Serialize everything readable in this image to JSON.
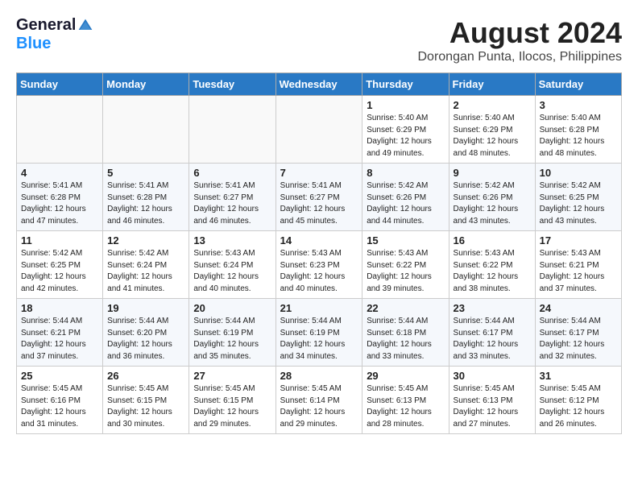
{
  "logo": {
    "general": "General",
    "blue": "Blue"
  },
  "title": "August 2024",
  "location": "Dorongan Punta, Ilocos, Philippines",
  "days_of_week": [
    "Sunday",
    "Monday",
    "Tuesday",
    "Wednesday",
    "Thursday",
    "Friday",
    "Saturday"
  ],
  "weeks": [
    [
      {
        "day": "",
        "info": ""
      },
      {
        "day": "",
        "info": ""
      },
      {
        "day": "",
        "info": ""
      },
      {
        "day": "",
        "info": ""
      },
      {
        "day": "1",
        "info": "Sunrise: 5:40 AM\nSunset: 6:29 PM\nDaylight: 12 hours\nand 49 minutes."
      },
      {
        "day": "2",
        "info": "Sunrise: 5:40 AM\nSunset: 6:29 PM\nDaylight: 12 hours\nand 48 minutes."
      },
      {
        "day": "3",
        "info": "Sunrise: 5:40 AM\nSunset: 6:28 PM\nDaylight: 12 hours\nand 48 minutes."
      }
    ],
    [
      {
        "day": "4",
        "info": "Sunrise: 5:41 AM\nSunset: 6:28 PM\nDaylight: 12 hours\nand 47 minutes."
      },
      {
        "day": "5",
        "info": "Sunrise: 5:41 AM\nSunset: 6:28 PM\nDaylight: 12 hours\nand 46 minutes."
      },
      {
        "day": "6",
        "info": "Sunrise: 5:41 AM\nSunset: 6:27 PM\nDaylight: 12 hours\nand 46 minutes."
      },
      {
        "day": "7",
        "info": "Sunrise: 5:41 AM\nSunset: 6:27 PM\nDaylight: 12 hours\nand 45 minutes."
      },
      {
        "day": "8",
        "info": "Sunrise: 5:42 AM\nSunset: 6:26 PM\nDaylight: 12 hours\nand 44 minutes."
      },
      {
        "day": "9",
        "info": "Sunrise: 5:42 AM\nSunset: 6:26 PM\nDaylight: 12 hours\nand 43 minutes."
      },
      {
        "day": "10",
        "info": "Sunrise: 5:42 AM\nSunset: 6:25 PM\nDaylight: 12 hours\nand 43 minutes."
      }
    ],
    [
      {
        "day": "11",
        "info": "Sunrise: 5:42 AM\nSunset: 6:25 PM\nDaylight: 12 hours\nand 42 minutes."
      },
      {
        "day": "12",
        "info": "Sunrise: 5:42 AM\nSunset: 6:24 PM\nDaylight: 12 hours\nand 41 minutes."
      },
      {
        "day": "13",
        "info": "Sunrise: 5:43 AM\nSunset: 6:24 PM\nDaylight: 12 hours\nand 40 minutes."
      },
      {
        "day": "14",
        "info": "Sunrise: 5:43 AM\nSunset: 6:23 PM\nDaylight: 12 hours\nand 40 minutes."
      },
      {
        "day": "15",
        "info": "Sunrise: 5:43 AM\nSunset: 6:22 PM\nDaylight: 12 hours\nand 39 minutes."
      },
      {
        "day": "16",
        "info": "Sunrise: 5:43 AM\nSunset: 6:22 PM\nDaylight: 12 hours\nand 38 minutes."
      },
      {
        "day": "17",
        "info": "Sunrise: 5:43 AM\nSunset: 6:21 PM\nDaylight: 12 hours\nand 37 minutes."
      }
    ],
    [
      {
        "day": "18",
        "info": "Sunrise: 5:44 AM\nSunset: 6:21 PM\nDaylight: 12 hours\nand 37 minutes."
      },
      {
        "day": "19",
        "info": "Sunrise: 5:44 AM\nSunset: 6:20 PM\nDaylight: 12 hours\nand 36 minutes."
      },
      {
        "day": "20",
        "info": "Sunrise: 5:44 AM\nSunset: 6:19 PM\nDaylight: 12 hours\nand 35 minutes."
      },
      {
        "day": "21",
        "info": "Sunrise: 5:44 AM\nSunset: 6:19 PM\nDaylight: 12 hours\nand 34 minutes."
      },
      {
        "day": "22",
        "info": "Sunrise: 5:44 AM\nSunset: 6:18 PM\nDaylight: 12 hours\nand 33 minutes."
      },
      {
        "day": "23",
        "info": "Sunrise: 5:44 AM\nSunset: 6:17 PM\nDaylight: 12 hours\nand 33 minutes."
      },
      {
        "day": "24",
        "info": "Sunrise: 5:44 AM\nSunset: 6:17 PM\nDaylight: 12 hours\nand 32 minutes."
      }
    ],
    [
      {
        "day": "25",
        "info": "Sunrise: 5:45 AM\nSunset: 6:16 PM\nDaylight: 12 hours\nand 31 minutes."
      },
      {
        "day": "26",
        "info": "Sunrise: 5:45 AM\nSunset: 6:15 PM\nDaylight: 12 hours\nand 30 minutes."
      },
      {
        "day": "27",
        "info": "Sunrise: 5:45 AM\nSunset: 6:15 PM\nDaylight: 12 hours\nand 29 minutes."
      },
      {
        "day": "28",
        "info": "Sunrise: 5:45 AM\nSunset: 6:14 PM\nDaylight: 12 hours\nand 29 minutes."
      },
      {
        "day": "29",
        "info": "Sunrise: 5:45 AM\nSunset: 6:13 PM\nDaylight: 12 hours\nand 28 minutes."
      },
      {
        "day": "30",
        "info": "Sunrise: 5:45 AM\nSunset: 6:13 PM\nDaylight: 12 hours\nand 27 minutes."
      },
      {
        "day": "31",
        "info": "Sunrise: 5:45 AM\nSunset: 6:12 PM\nDaylight: 12 hours\nand 26 minutes."
      }
    ]
  ]
}
